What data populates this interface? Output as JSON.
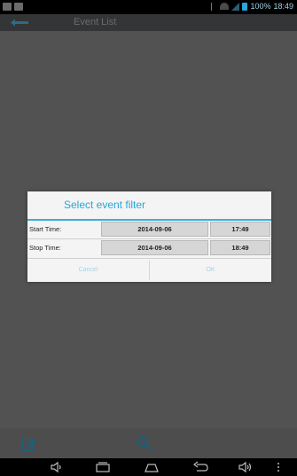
{
  "status_bar": {
    "battery_text": "100%",
    "time": "18:49",
    "accent_color": "#2aa6d8"
  },
  "action_bar": {
    "title": "Event List",
    "back_icon": "back-arrow-icon"
  },
  "dialog": {
    "title": "Select event filter",
    "rows": [
      {
        "label": "Start Time:",
        "date": "2014-09-06",
        "time": "17:49"
      },
      {
        "label": "Stop Time:",
        "date": "2014-09-06",
        "time": "18:49"
      }
    ],
    "cancel_label": "Cancel",
    "ok_label": "OK",
    "title_color": "#27a6d9"
  },
  "bottom_bar": {
    "icons": [
      "edit-icon",
      "search-icon"
    ]
  },
  "nav_bar": {
    "icons": [
      "volume-down-icon",
      "recent-apps-icon",
      "home-icon",
      "back-icon",
      "volume-up-icon",
      "menu-icon"
    ]
  }
}
